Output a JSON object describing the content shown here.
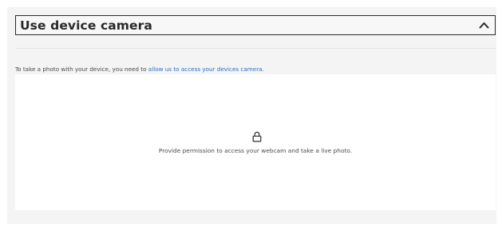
{
  "accordion": {
    "title": "Use device camera",
    "toggle_icon": "chevron-up-icon"
  },
  "instruction": {
    "prefix": "To take a photo with your device, you need to ",
    "link": "allow us to access your devices camera."
  },
  "camera": {
    "icon": "lock-icon",
    "message": "Provide permission to access your webcam and take a live photo."
  },
  "colors": {
    "panel_bg": "#f4f4f5",
    "link": "#2c6fc2",
    "text": "#4a4a4a",
    "title": "#2a2a2a"
  }
}
